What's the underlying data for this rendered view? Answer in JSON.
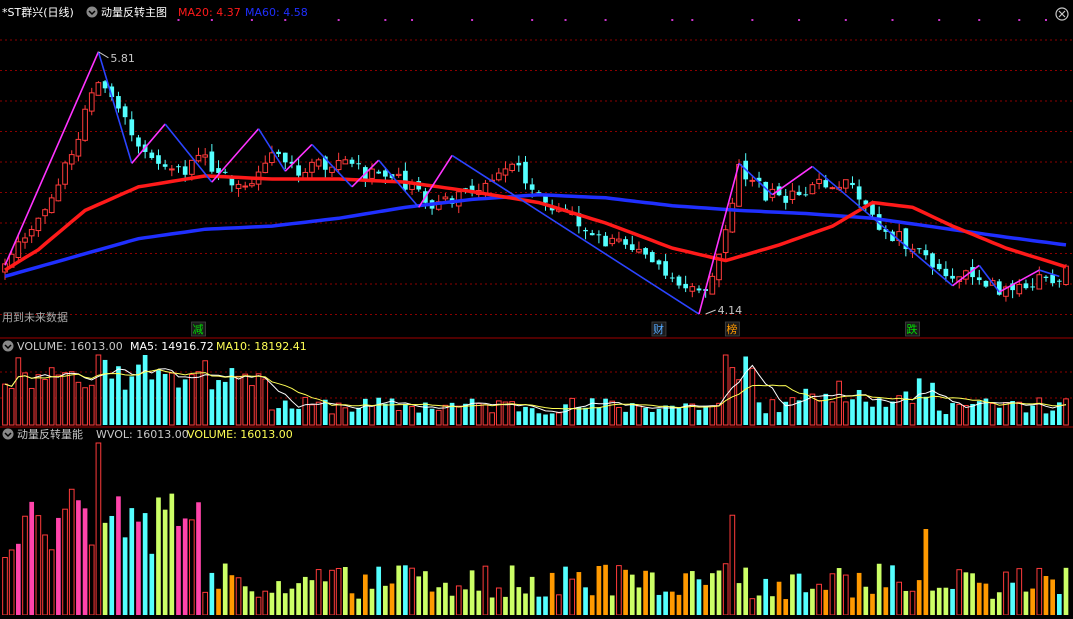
{
  "window": {
    "title": "*ST群兴(日线)",
    "main_indicator": "动量反转主图",
    "volume_panel": "VOLUME",
    "bottom_panel": "动量反转量能"
  },
  "colors": {
    "background": "#000000",
    "grid": "#8b0000",
    "up": "#ff3b3b",
    "down": "#54ffff",
    "ma20": "#ff1a1a",
    "ma60": "#1f2fff",
    "zigzag_up": "#ff33ff",
    "zigzag_down": "#2b44ff",
    "ma5_vol": "#ffffff",
    "ma10_vol": "#ffff55",
    "bright_vol": "#ccff66",
    "orange": "#ff9900"
  },
  "icons": {
    "collapse": "collapse-icon",
    "close": "close-icon"
  },
  "chart_data": [
    {
      "type": "candlestick",
      "name_label": "动量反转主图",
      "legend": [
        {
          "label": "MA20",
          "value": "4.37",
          "color": "#ff1a1a"
        },
        {
          "label": "MA60",
          "value": "4.58",
          "color": "#1f2fff"
        }
      ],
      "ylim": [
        4.0,
        6.0
      ],
      "annotations": {
        "high": {
          "index": 14,
          "value": 5.81,
          "label": "5.81"
        },
        "low": {
          "index": 105,
          "value": 4.14,
          "label": "4.14"
        },
        "note": "用到未来数据",
        "tags": [
          {
            "index": 29,
            "text": "减",
            "color": "#00dd00"
          },
          {
            "index": 98,
            "text": "财",
            "color": "#55aaff"
          },
          {
            "index": 109,
            "text": "榜",
            "color": "#ff9900"
          },
          {
            "index": 136,
            "text": "跌",
            "color": "#00dd00"
          }
        ]
      },
      "ohlc_params": {
        "count": 160,
        "amplitude_scale": 0.06,
        "seed": 7
      },
      "price_path": [
        [
          0,
          4.42
        ],
        [
          3,
          4.62
        ],
        [
          8,
          4.95
        ],
        [
          14,
          5.62
        ],
        [
          18,
          5.35
        ],
        [
          22,
          5.15
        ],
        [
          26,
          5.05
        ],
        [
          30,
          5.12
        ],
        [
          36,
          4.95
        ],
        [
          40,
          5.2
        ],
        [
          44,
          5.05
        ],
        [
          50,
          5.1
        ],
        [
          56,
          5.02
        ],
        [
          60,
          4.98
        ],
        [
          64,
          4.82
        ],
        [
          68,
          4.9
        ],
        [
          72,
          4.98
        ],
        [
          76,
          5.1
        ],
        [
          82,
          4.82
        ],
        [
          86,
          4.72
        ],
        [
          90,
          4.6
        ],
        [
          96,
          4.52
        ],
        [
          100,
          4.38
        ],
        [
          105,
          4.27
        ],
        [
          108,
          4.7
        ],
        [
          110,
          5.05
        ],
        [
          114,
          4.9
        ],
        [
          118,
          4.88
        ],
        [
          122,
          4.95
        ],
        [
          126,
          4.98
        ],
        [
          130,
          4.75
        ],
        [
          134,
          4.62
        ],
        [
          138,
          4.5
        ],
        [
          142,
          4.4
        ],
        [
          146,
          4.36
        ],
        [
          150,
          4.28
        ],
        [
          155,
          4.35
        ],
        [
          159,
          4.4
        ]
      ],
      "ma20_path": [
        [
          0,
          4.42
        ],
        [
          5,
          4.55
        ],
        [
          12,
          4.8
        ],
        [
          20,
          4.95
        ],
        [
          30,
          5.02
        ],
        [
          40,
          5.0
        ],
        [
          50,
          5.0
        ],
        [
          60,
          4.98
        ],
        [
          70,
          4.92
        ],
        [
          80,
          4.85
        ],
        [
          90,
          4.72
        ],
        [
          100,
          4.56
        ],
        [
          108,
          4.48
        ],
        [
          116,
          4.58
        ],
        [
          124,
          4.7
        ],
        [
          130,
          4.85
        ],
        [
          136,
          4.82
        ],
        [
          142,
          4.7
        ],
        [
          150,
          4.56
        ],
        [
          159,
          4.44
        ]
      ],
      "ma60_path": [
        [
          0,
          4.38
        ],
        [
          10,
          4.5
        ],
        [
          20,
          4.62
        ],
        [
          30,
          4.68
        ],
        [
          40,
          4.7
        ],
        [
          50,
          4.75
        ],
        [
          60,
          4.82
        ],
        [
          70,
          4.87
        ],
        [
          80,
          4.9
        ],
        [
          90,
          4.88
        ],
        [
          100,
          4.83
        ],
        [
          110,
          4.8
        ],
        [
          120,
          4.78
        ],
        [
          130,
          4.75
        ],
        [
          140,
          4.69
        ],
        [
          150,
          4.63
        ],
        [
          159,
          4.58
        ]
      ],
      "zigzag": [
        [
          0,
          4.45
        ],
        [
          14,
          5.81
        ],
        [
          19,
          5.1
        ],
        [
          24,
          5.35
        ],
        [
          31,
          4.98
        ],
        [
          38,
          5.32
        ],
        [
          42,
          5.05
        ],
        [
          46,
          5.22
        ],
        [
          52,
          4.95
        ],
        [
          56,
          5.12
        ],
        [
          62,
          4.82
        ],
        [
          67,
          5.15
        ],
        [
          104,
          4.14
        ],
        [
          110,
          5.1
        ],
        [
          115,
          4.9
        ],
        [
          121,
          5.08
        ],
        [
          142,
          4.32
        ],
        [
          146,
          4.45
        ],
        [
          149,
          4.28
        ],
        [
          155,
          4.42
        ],
        [
          158,
          4.38
        ]
      ]
    },
    {
      "type": "bar",
      "name_label": "VOLUME",
      "legend": [
        {
          "label": "VOLUME",
          "value": "16013.00",
          "color": "#c8c8c8"
        },
        {
          "label": "MA5",
          "value": "14916.72",
          "color": "#ffffff"
        },
        {
          "label": "MA10",
          "value": "18192.41",
          "color": "#ffff55"
        }
      ],
      "volume_params": {
        "count": 160,
        "seed": 11
      }
    },
    {
      "type": "bar",
      "name_label": "动量反转量能",
      "legend": [
        {
          "label": "WVOL",
          "value": "16013.00",
          "color": "#c8c8c8"
        },
        {
          "label": "VOLUME",
          "value": "16013.00",
          "color": "#ffff55"
        }
      ],
      "wvol_params": {
        "count": 160,
        "seed": 19
      }
    }
  ]
}
